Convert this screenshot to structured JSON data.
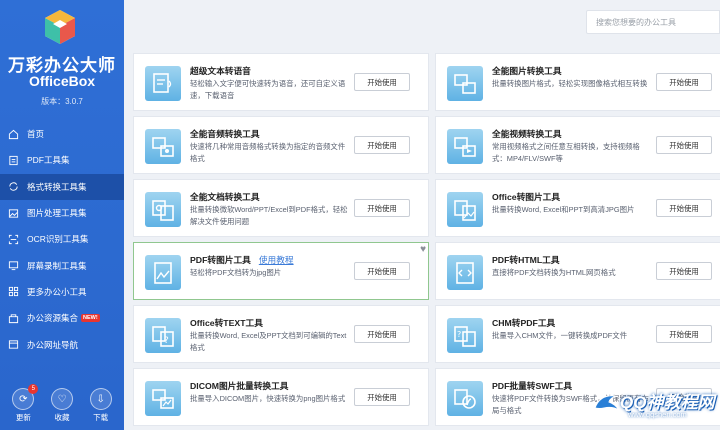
{
  "app": {
    "title": "万彩办公大师",
    "subtitle": "OfficeBox",
    "version": "版本：3.0.7"
  },
  "nav": [
    {
      "label": "首页",
      "icon": "home-icon"
    },
    {
      "label": "PDF工具集",
      "icon": "pdf-icon"
    },
    {
      "label": "格式转换工具集",
      "icon": "convert-icon"
    },
    {
      "label": "图片处理工具集",
      "icon": "image-icon"
    },
    {
      "label": "OCR识别工具集",
      "icon": "ocr-icon"
    },
    {
      "label": "屏幕录制工具集",
      "icon": "screen-icon"
    },
    {
      "label": "更多办公小工具",
      "icon": "grid-icon"
    },
    {
      "label": "办公资源集合",
      "icon": "resource-icon",
      "badge": "NEW!"
    },
    {
      "label": "办公网址导航",
      "icon": "link-icon"
    }
  ],
  "bottom": {
    "update": "更新",
    "update_count": "5",
    "favorite": "收藏",
    "download": "下载"
  },
  "search": {
    "placeholder": "搜索您想要的办公工具"
  },
  "button_label": "开始使用",
  "cards": [
    {
      "title": "超级文本转语音",
      "desc": "轻松输入文字便可快速转为语音，还可自定义语速，下载语音",
      "icon": "text-to-speech-icon"
    },
    {
      "title": "全能图片转换工具",
      "desc": "批量转换图片格式，轻松实现图像格式相互转换",
      "icon": "image-convert-icon"
    },
    {
      "title": "全能音频转换工具",
      "desc": "快速将几种常用音频格式转换为指定的音频文件格式",
      "icon": "audio-convert-icon"
    },
    {
      "title": "全能视频转换工具",
      "desc": "常用视频格式之间任意互相转换，支持视频格式：MP4/FLV/SWF等",
      "icon": "video-convert-icon"
    },
    {
      "title": "全能文档转换工具",
      "desc": "批量转换微软Word/PPT/Excel到PDF格式，轻松解决文件使用问题",
      "icon": "doc-convert-icon"
    },
    {
      "title": "Office转图片工具",
      "desc": "批量转换Word, Excel和PPT到高清JPG图片",
      "icon": "office-to-image-icon"
    },
    {
      "title": "PDF转图片工具",
      "tutorial": "使用教程",
      "desc": "轻松将PDF文档转为jpg图片",
      "icon": "pdf-to-image-icon"
    },
    {
      "title": "PDF转HTML工具",
      "desc": "直接将PDF文档转换为HTML网页格式",
      "icon": "pdf-to-html-icon"
    },
    {
      "title": "Office转TEXT工具",
      "desc": "批量转换Word, Excel及PPT文档到可编辑的Text格式",
      "icon": "office-to-text-icon"
    },
    {
      "title": "CHM转PDF工具",
      "desc": "批量导入CHM文件，一键转换成PDF文件",
      "icon": "chm-to-pdf-icon"
    },
    {
      "title": "DICOM图片批量转换工具",
      "desc": "批量导入DICOM图片，快速转换为png图片格式",
      "icon": "dicom-icon"
    },
    {
      "title": "PDF批量转SWF工具",
      "desc": "快速将PDF文件转换为SWF格式，并保留原有布局与格式",
      "icon": "pdf-to-swf-icon"
    }
  ],
  "watermark": {
    "name": "QQ神教程网",
    "url": "www.qqshen.com"
  }
}
